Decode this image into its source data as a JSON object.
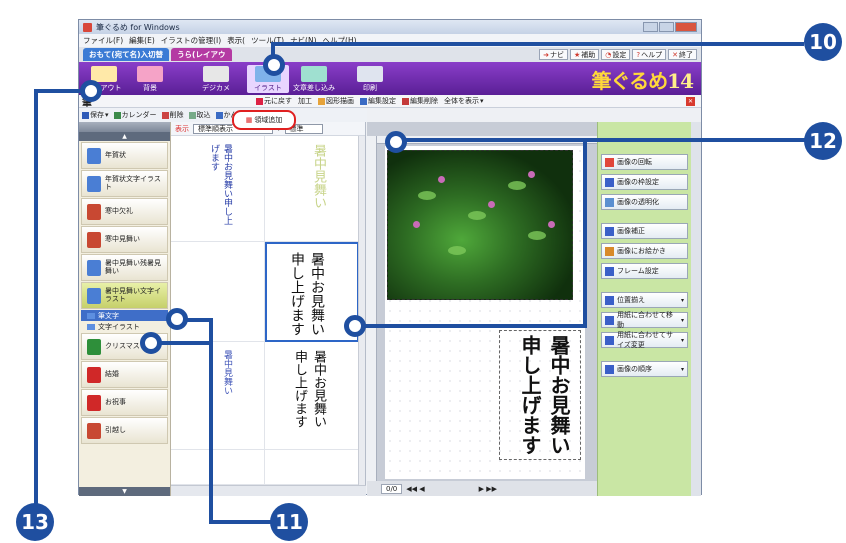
{
  "window": {
    "title": "筆ぐるめ for Windows",
    "menu": [
      "ファイル(F)",
      "編集(E)",
      "イラストの管理(I)",
      "表示(",
      "ツール(T)",
      "ナビ(N)",
      "ヘルプ(H)"
    ]
  },
  "tabs": {
    "front": "おもて(宛て名)入切替",
    "back": "うら(レイアウ",
    "right_buttons": [
      "ナビ",
      "補助",
      "設定",
      "ヘルプ",
      "終了"
    ]
  },
  "ribbon": {
    "buttons": [
      "レイアウト",
      "背景",
      "デジカメ",
      "イラスト",
      "文章差し込み",
      "印刷"
    ],
    "logo": "筆ぐるめ",
    "logo_version": "14"
  },
  "subtoolbar": {
    "title": "筆",
    "items": [
      "元に戻す",
      "加工",
      "図形描画",
      "編集設定",
      "編集削除",
      "全体を表示"
    ]
  },
  "toolbar2": {
    "items": [
      "保存",
      "カレンダー",
      "削除",
      "取込",
      "かんたんレイアウト"
    ],
    "area_add": "領域追加"
  },
  "categories": [
    {
      "label": "年賀状",
      "color": "#4a7ed4"
    },
    {
      "label": "年賀状文字イラスト",
      "color": "#4a7ed4"
    },
    {
      "label": "寒中欠礼",
      "color": "#c84832"
    },
    {
      "label": "寒中見舞い",
      "color": "#c84832"
    },
    {
      "label": "暑中見舞い残暑見舞い",
      "color": "#4a7ed4"
    },
    {
      "label": "暑中見舞い文字イラスト",
      "color": "#4a7ed4"
    }
  ],
  "subcategories": [
    {
      "label": "筆文字"
    },
    {
      "label": "文字イラスト"
    }
  ],
  "categories_bottom": [
    {
      "label": "クリスマス",
      "color": "#2e8f3a"
    },
    {
      "label": "結婚",
      "color": "#d02828"
    },
    {
      "label": "お祝事",
      "color": "#d02828"
    },
    {
      "label": "引越し",
      "color": "#c84832"
    }
  ],
  "thumbs_bar": {
    "show": "表示",
    "sort": "標準順表示",
    "sort2": "標準"
  },
  "thumbnails": [
    {
      "text": "暑中お見舞い申し上げます",
      "color": "#2a3fa8",
      "size": 9
    },
    {
      "text": "暑中見舞い",
      "color": "#c8d48a",
      "size": 13
    },
    {
      "text": "",
      "color": "#666",
      "size": 8
    },
    {
      "text": "暑中お見舞い申し上げます",
      "color": "#111",
      "size": 14
    },
    {
      "text": "暑中見舞い",
      "color": "#4156b8",
      "size": 9
    },
    {
      "text": "暑中お見舞い申し上げます",
      "color": "#111",
      "size": 13
    }
  ],
  "canvas": {
    "calligraphy": "暑中お見舞い申し上げます",
    "page": "0/0"
  },
  "right_panel": {
    "group1": [
      {
        "label": "画像の回転",
        "color": "#e0463a"
      },
      {
        "label": "画像の枠設定",
        "color": "#3a5fc8"
      },
      {
        "label": "画像の透明化",
        "color": "#5a8fd0"
      }
    ],
    "group2": [
      {
        "label": "画像補正",
        "color": "#3a5fc8"
      },
      {
        "label": "画像にお絵かき",
        "color": "#d88a2a"
      },
      {
        "label": "フレーム設定",
        "color": "#3a5fc8"
      }
    ],
    "group3": [
      {
        "label": "位置揃え",
        "color": "#3a5fc8",
        "dropdown": true
      },
      {
        "label": "用紙に合わせて移動",
        "color": "#3a5fc8",
        "dropdown": true
      },
      {
        "label": "用紙に合わせてサイズ変更",
        "color": "#3a5fc8",
        "dropdown": true
      }
    ],
    "group4": [
      {
        "label": "画像の順序",
        "color": "#3a5fc8",
        "dropdown": true
      }
    ]
  },
  "callouts": [
    "10",
    "11",
    "12",
    "13"
  ],
  "accent": "#1f4fa0"
}
